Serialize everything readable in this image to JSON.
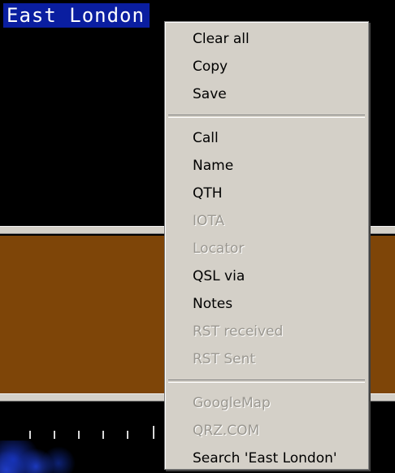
{
  "background": {
    "selected_text": "East London"
  },
  "context_menu": {
    "groups": [
      [
        {
          "label": "Clear all",
          "enabled": true
        },
        {
          "label": "Copy",
          "enabled": true
        },
        {
          "label": "Save",
          "enabled": true
        }
      ],
      [
        {
          "label": "Call",
          "enabled": true
        },
        {
          "label": "Name",
          "enabled": true
        },
        {
          "label": "QTH",
          "enabled": true
        },
        {
          "label": "IOTA",
          "enabled": false
        },
        {
          "label": "Locator",
          "enabled": false
        },
        {
          "label": "QSL via",
          "enabled": true
        },
        {
          "label": "Notes",
          "enabled": true
        },
        {
          "label": "RST received",
          "enabled": false
        },
        {
          "label": "RST Sent",
          "enabled": false
        }
      ],
      [
        {
          "label": "GoogleMap",
          "enabled": false
        },
        {
          "label": "QRZ.COM",
          "enabled": false
        },
        {
          "label": "Search 'East London'",
          "enabled": true
        }
      ]
    ]
  },
  "colors": {
    "selection": "#0a1ea0",
    "brown_pane": "#7e4508",
    "menu_background": "#d4d0c8",
    "disabled_text": "#9a9790"
  }
}
